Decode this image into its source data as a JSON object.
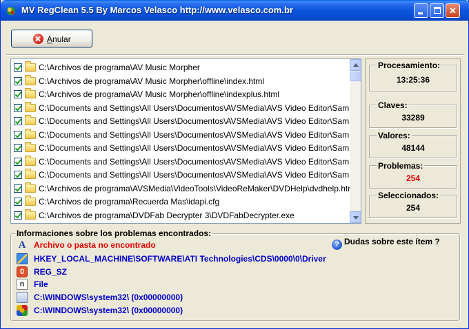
{
  "window": {
    "title": "MV RegClean 5.5   By Marcos Velasco   http://www.velasco.com.br",
    "controls": {
      "minimize": "minimize-icon",
      "maximize": "maximize-icon",
      "close": "close-icon"
    }
  },
  "toolbar": {
    "anular_label": "Anular",
    "anular_icon": "cancel-icon"
  },
  "list": {
    "items": [
      "C:\\Archivos de programa\\AV Music Morpher",
      "C:\\Archivos de programa\\AV Music Morpher\\offline\\index.html",
      "C:\\Archivos de programa\\AV Music Morpher\\offline\\indexplus.html",
      "C:\\Documents and Settings\\All Users\\Documentos\\AVSMedia\\AVS Video Editor\\Samp",
      "C:\\Documents and Settings\\All Users\\Documentos\\AVSMedia\\AVS Video Editor\\Samp",
      "C:\\Documents and Settings\\All Users\\Documentos\\AVSMedia\\AVS Video Editor\\Samp",
      "C:\\Documents and Settings\\All Users\\Documentos\\AVSMedia\\AVS Video Editor\\Samp",
      "C:\\Documents and Settings\\All Users\\Documentos\\AVSMedia\\AVS Video Editor\\Samp",
      "C:\\Documents and Settings\\All Users\\Documentos\\AVSMedia\\AVS Video Editor\\Samp",
      "C:\\Archivos de programa\\AVSMedia\\VideoTools\\VideoReMaker\\DVDHelp\\dvdhelp.htr",
      "C:\\Archivos de programa\\Recuerda Mas\\idapi.cfg",
      "C:\\Archivos de programa\\DVDFab Decrypter 3\\DVDFabDecrypter.exe"
    ]
  },
  "stats": {
    "procesamiento": {
      "label": "Procesamiento:",
      "value": "13:25:36"
    },
    "claves": {
      "label": "Claves:",
      "value": "33289"
    },
    "valores": {
      "label": "Valores:",
      "value": "48144"
    },
    "problemas": {
      "label": "Problemas:",
      "value": "254"
    },
    "seleccionados": {
      "label": "Seleccionados:",
      "value": "254"
    }
  },
  "info": {
    "title": "Informaciones sobre los problemas encontrados:",
    "help": "Dudas sobre este ítem ?",
    "rows": [
      {
        "icon": "letter-a-icon",
        "text": "Archivo o pasta no encontrado",
        "color": "#e00000"
      },
      {
        "icon": "registry-key-icon",
        "text": "HKEY_LOCAL_MACHINE\\SOFTWARE\\ATI Technologies\\CDS\\0000\\0\\Driver",
        "color": "#0000cc"
      },
      {
        "icon": "registry-value-icon",
        "text": "REG_SZ",
        "color": "#0000cc"
      },
      {
        "icon": "file-icon",
        "text": "File",
        "color": "#0000cc"
      },
      {
        "icon": "document-icon",
        "text": "C:\\WINDOWS\\system32\\ (0x00000000)",
        "color": "#0000cc"
      },
      {
        "icon": "component-icon",
        "text": "C:\\WINDOWS\\system32\\ (0x00000000)",
        "color": "#0000cc"
      }
    ]
  }
}
